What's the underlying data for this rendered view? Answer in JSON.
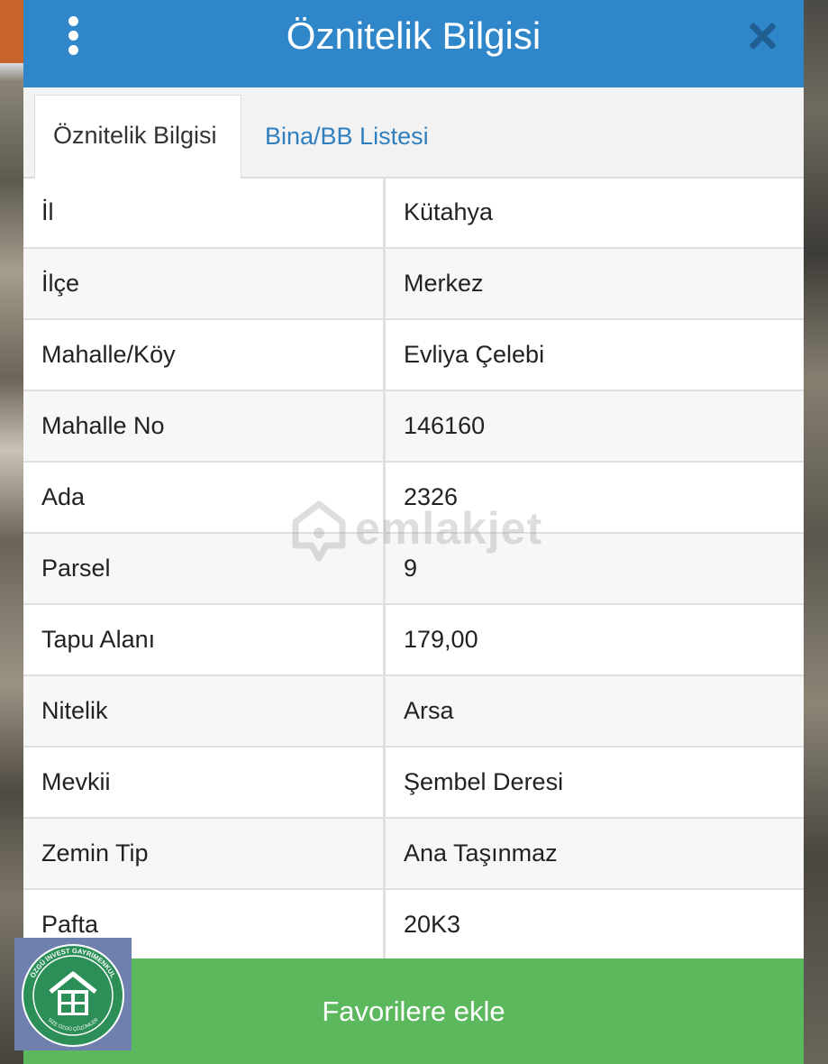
{
  "header": {
    "title": "Öznitelik Bilgisi"
  },
  "tabs": [
    {
      "label": "Öznitelik Bilgisi",
      "active": true
    },
    {
      "label": "Bina/BB Listesi",
      "active": false
    }
  ],
  "attributes": [
    {
      "key": "İl",
      "value": "Kütahya"
    },
    {
      "key": "İlçe",
      "value": "Merkez"
    },
    {
      "key": "Mahalle/Köy",
      "value": "Evliya Çelebi"
    },
    {
      "key": "Mahalle No",
      "value": "146160"
    },
    {
      "key": "Ada",
      "value": "2326"
    },
    {
      "key": "Parsel",
      "value": "9"
    },
    {
      "key": "Tapu Alanı",
      "value": "179,00"
    },
    {
      "key": "Nitelik",
      "value": "Arsa"
    },
    {
      "key": "Mevkii",
      "value": "Şembel Deresi"
    },
    {
      "key": "Zemin Tip",
      "value": "Ana Taşınmaz"
    },
    {
      "key": "Pafta",
      "value": "20K3"
    }
  ],
  "watermark": {
    "text": "emlakjet"
  },
  "logo": {
    "top_text": "ÖZGÜ İNVEST GAYRİMENKUL",
    "bottom_text": "SİZE ÖZGÜ ÇÖZÜMLER"
  },
  "footer": {
    "favorite_label": "Favorilere ekle"
  },
  "colors": {
    "header": "#2f86c8",
    "tab_link": "#2f7fbf",
    "favorite_button": "#5cb85c"
  },
  "icons": {
    "menu": "kebab-menu-icon",
    "close": "close-icon"
  }
}
